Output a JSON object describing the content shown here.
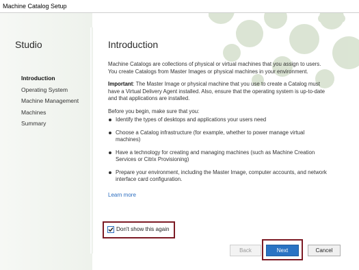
{
  "window": {
    "title": "Machine Catalog Setup"
  },
  "sidebar": {
    "heading": "Studio",
    "steps": [
      {
        "label": "Introduction",
        "active": true
      },
      {
        "label": "Operating System",
        "active": false
      },
      {
        "label": "Machine Management",
        "active": false
      },
      {
        "label": "Machines",
        "active": false
      },
      {
        "label": "Summary",
        "active": false
      }
    ]
  },
  "main": {
    "heading": "Introduction",
    "intro": "Machine Catalogs are collections of physical or virtual machines that you assign to users. You create Catalogs from Master Images or physical machines in your environment.",
    "important_label": "Important",
    "important_text": ": The Master Image or physical machine that you use to create a Catalog must have a Virtual Delivery Agent installed. Also, ensure that the operating system is up-to-date and that applications are installed.",
    "before_text": "Before you begin, make sure that you:",
    "bullets": [
      "Identify the types of desktops and applications your users need",
      "Choose a Catalog infrastructure (for example, whether to power manage virtual machines)",
      "Have a technology for creating and managing machines (such as Machine Creation Services or Citrix Provisioning)",
      "Prepare your environment, including the Master Image, computer accounts, and network interface card configuration."
    ],
    "learn_more": "Learn more"
  },
  "dont_show": {
    "label": "Don't show this again",
    "checked": true
  },
  "buttons": {
    "back": "Back",
    "next": "Next",
    "cancel": "Cancel"
  },
  "colors": {
    "accent": "#2a73c3",
    "highlight": "#7c1a24",
    "decor": "#cfdcc6"
  }
}
